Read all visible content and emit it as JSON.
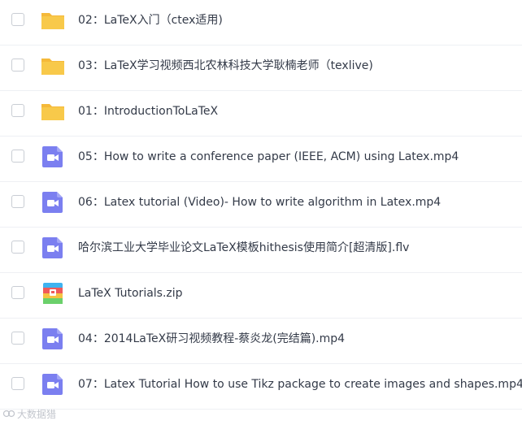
{
  "colors": {
    "folder": "#f8c94a",
    "folder_tab": "#f5b93a",
    "video": "#7b7ff0",
    "zip_bands": [
      "#3fb3f0",
      "#f05a5a",
      "#f5c242",
      "#6bd06b"
    ]
  },
  "files": [
    {
      "name": "02：LaTeX入门（ctex适用)",
      "icon": "folder-icon"
    },
    {
      "name": "03：LaTeX学习视频西北农林科技大学耿楠老师（texlive)",
      "icon": "folder-icon"
    },
    {
      "name": "01：IntroductionToLaTeX",
      "icon": "folder-icon"
    },
    {
      "name": "05：How to write a conference paper (IEEE, ACM) using Latex.mp4",
      "icon": "video-icon"
    },
    {
      "name": "06：Latex tutorial (Video)- How to write algorithm in Latex.mp4",
      "icon": "video-icon"
    },
    {
      "name": "哈尔滨工业大学毕业论文LaTeX模板hithesis使用简介[超清版].flv",
      "icon": "video-icon"
    },
    {
      "name": "LaTeX Tutorials.zip",
      "icon": "zip-icon"
    },
    {
      "name": "04：2014LaTeX研习视频教程-蔡炎龙(完结篇).mp4",
      "icon": "video-icon"
    },
    {
      "name": "07：Latex Tutorial How to use Tikz package to create images and shapes.mp4",
      "icon": "video-icon"
    }
  ],
  "watermark": "大数据猎"
}
